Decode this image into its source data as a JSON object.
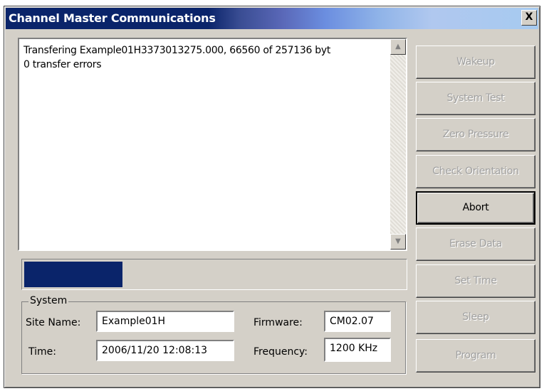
{
  "window": {
    "title": "Channel Master Communications",
    "close_label": "X"
  },
  "log": {
    "lines": [
      "Transfering Example01H3373013275.000, 66560 of 257136 byt",
      "0 transfer errors"
    ]
  },
  "progress": {
    "bytes_done": 66560,
    "bytes_total": 257136
  },
  "system": {
    "legend": "System",
    "site_name_label": "Site Name:",
    "site_name_value": "Example01H",
    "time_label": "Time:",
    "time_value": "2006/11/20 12:08:13",
    "firmware_label": "Firmware:",
    "firmware_value": "CM02.07",
    "frequency_label": "Frequency:",
    "frequency_value": "1200 KHz"
  },
  "buttons": [
    {
      "label": "Wakeup",
      "enabled": false
    },
    {
      "label": "System Test",
      "enabled": false
    },
    {
      "label": "Zero Pressure",
      "enabled": false
    },
    {
      "label": "Check Orientation",
      "enabled": false
    },
    {
      "label": "Abort",
      "enabled": true
    },
    {
      "label": "Erase Data",
      "enabled": false
    },
    {
      "label": "Set Time",
      "enabled": false
    },
    {
      "label": "Sleep",
      "enabled": false
    },
    {
      "label": "Program",
      "enabled": false
    }
  ],
  "icons": {
    "scroll_up": "scroll-up-arrow-icon",
    "scroll_down": "scroll-down-arrow-icon"
  }
}
